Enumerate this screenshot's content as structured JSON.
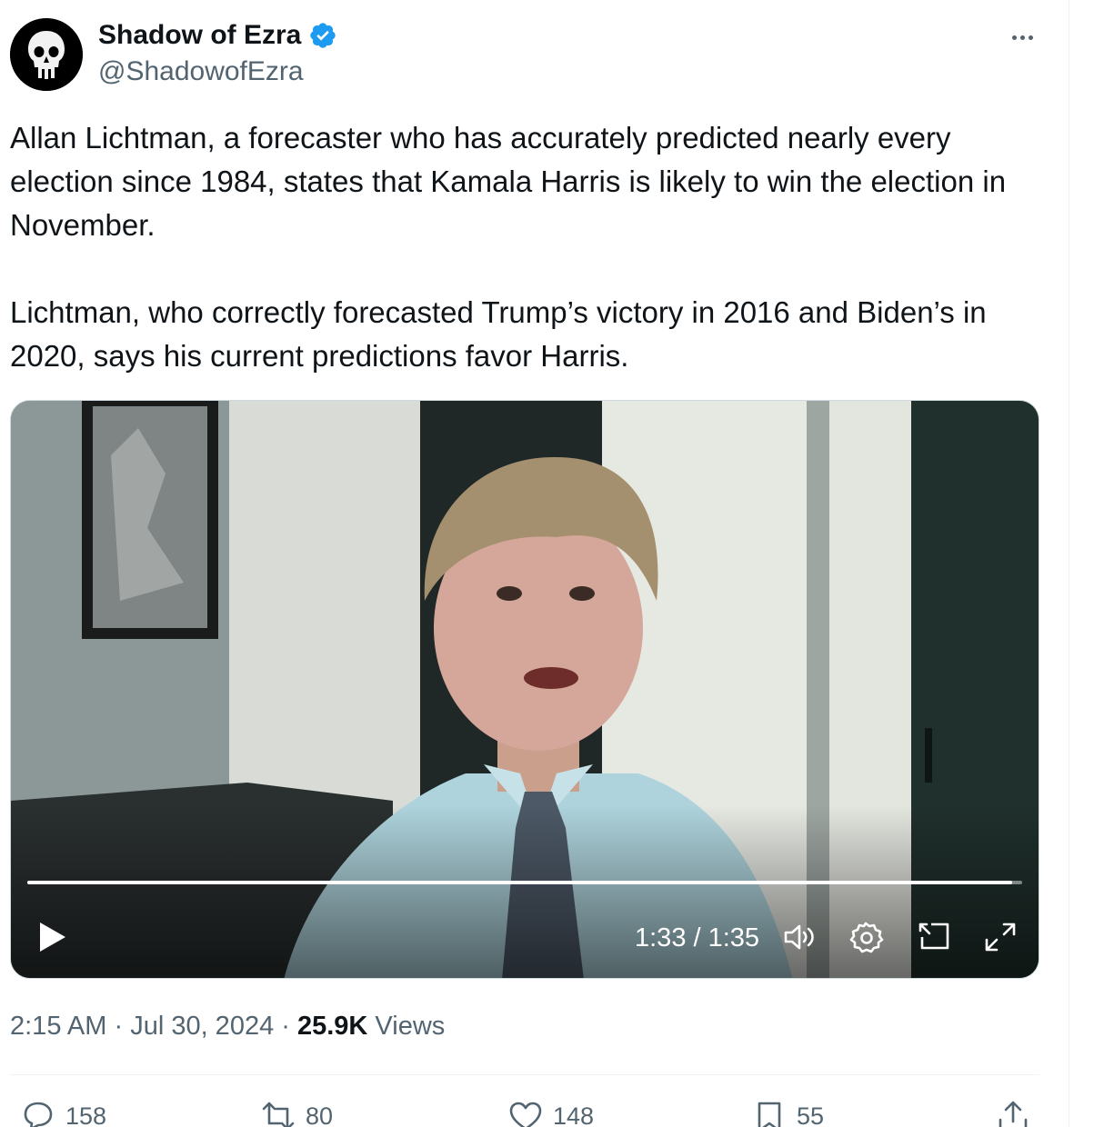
{
  "author": {
    "name": "Shadow of Ezra",
    "handle": "@ShadowofEzra",
    "verified": true,
    "verified_color": "#1d9bf0"
  },
  "tweet": {
    "paragraphs": [
      "Allan Lichtman, a forecaster who has accurately predicted nearly every election since 1984, states that Kamala Harris is likely to win the election in November.",
      "Lichtman, who correctly forecasted Trump’s victory in 2016 and Biden’s in 2020, says his current predictions favor Harris."
    ]
  },
  "video": {
    "time_label": "1:33 / 1:35",
    "progress": 0.99,
    "controls": [
      "play-icon",
      "volume-icon",
      "settings-icon",
      "picture-in-picture-icon",
      "fullscreen-icon"
    ]
  },
  "meta": {
    "time": "2:15 AM",
    "sep1": " · ",
    "date": "Jul 30, 2024",
    "sep2": " · ",
    "views_count": "25.9K",
    "views_label": " Views"
  },
  "actions": {
    "replies": "158",
    "reposts": "80",
    "likes": "148",
    "bookmarks": "55"
  },
  "colors": {
    "text": "#0f1419",
    "secondary": "#536471",
    "accent": "#1d9bf0"
  }
}
